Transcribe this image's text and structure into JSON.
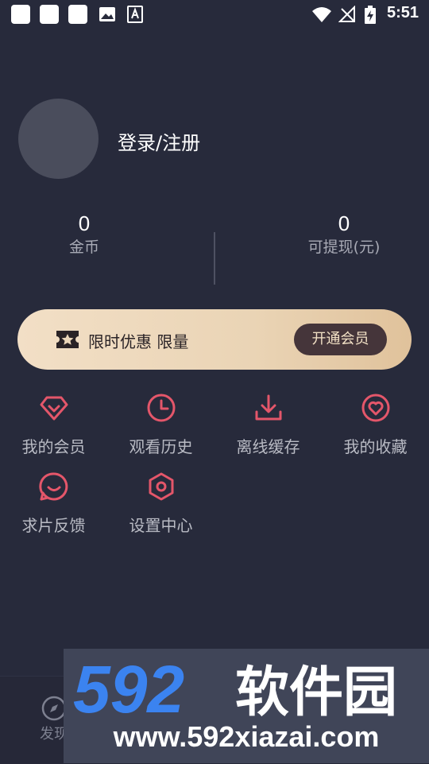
{
  "status_bar": {
    "time": "5:51"
  },
  "profile": {
    "login_label": "登录/注册"
  },
  "stats": {
    "coins": {
      "value": "0",
      "label": "金币"
    },
    "withdrawable": {
      "value": "0",
      "label": "可提现(元)"
    }
  },
  "vip_banner": {
    "promo_text": "限时优惠 限量",
    "button_label": "开通会员"
  },
  "menu": {
    "items": [
      {
        "label": "我的会员",
        "icon": "diamond-icon"
      },
      {
        "label": "观看历史",
        "icon": "clock-icon"
      },
      {
        "label": "离线缓存",
        "icon": "download-icon"
      },
      {
        "label": "我的收藏",
        "icon": "heart-icon"
      },
      {
        "label": "求片反馈",
        "icon": "feedback-icon"
      },
      {
        "label": "设置中心",
        "icon": "settings-icon"
      }
    ]
  },
  "bottom_nav": {
    "discover_label": "发现"
  },
  "watermark": {
    "brand_number": "592",
    "brand_name": "软件园",
    "url": "www.592xiazai.com"
  },
  "colors": {
    "background": "#272a3b",
    "accent_icon": "#e4566a",
    "vip_gold": "#ecd7ba",
    "vip_button": "#45353a"
  }
}
